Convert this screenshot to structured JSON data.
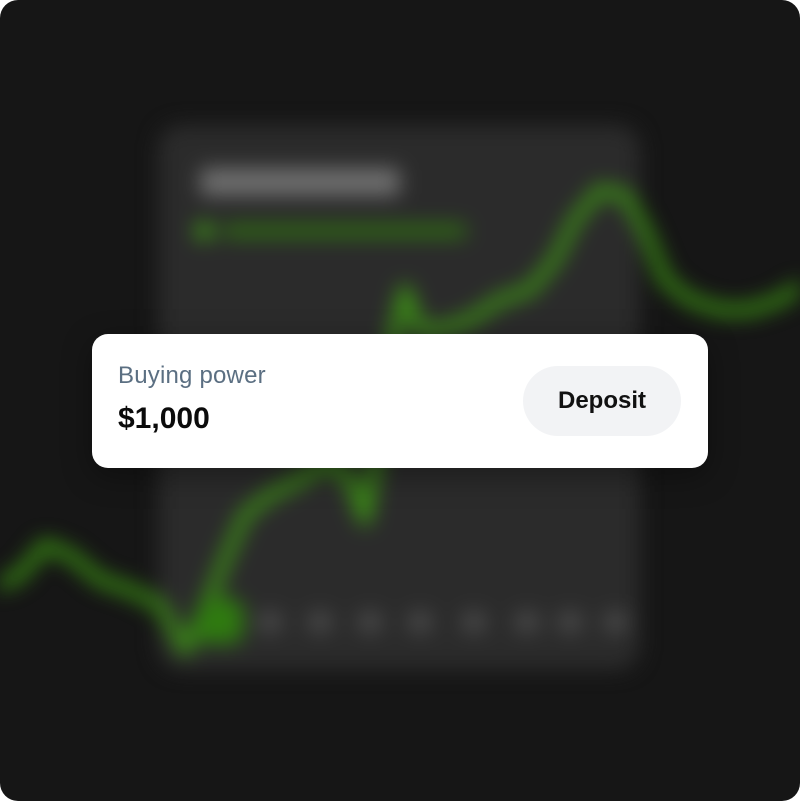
{
  "card": {
    "label": "Buying power",
    "value": "$1,000",
    "deposit_button": "Deposit"
  },
  "colors": {
    "background": "#161616",
    "card_background": "#ffffff",
    "label_color": "#5b6f82",
    "value_color": "#0b0b0b",
    "button_background": "#f2f3f5",
    "chart_line": "#3fa013"
  }
}
